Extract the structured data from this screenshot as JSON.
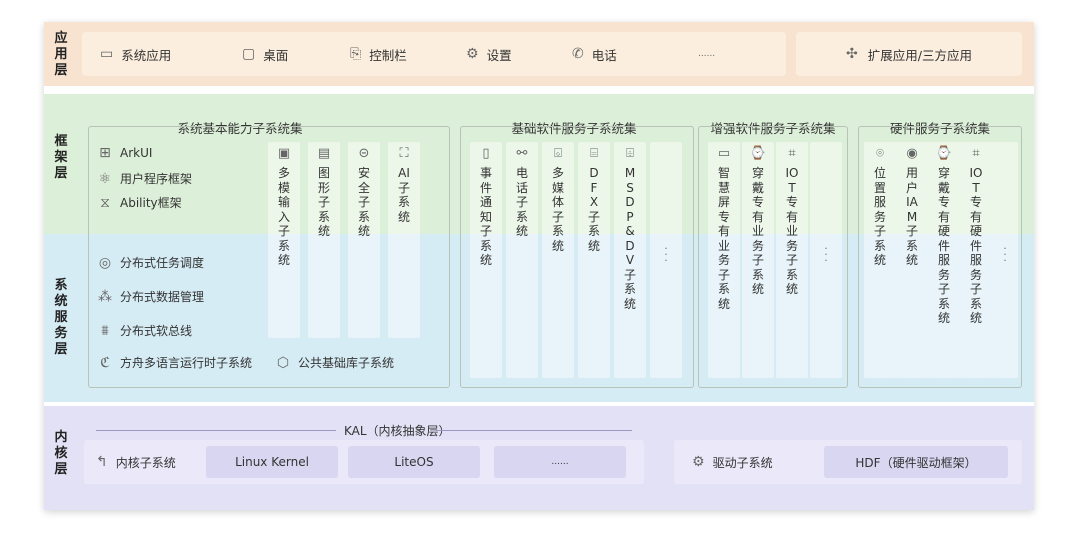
{
  "layers": {
    "app": "应用层",
    "framework": "框架层",
    "system": "系统服务层",
    "kernel": "内核层"
  },
  "app_layer": {
    "items": [
      {
        "label": "系统应用",
        "icon": "app-window-icon"
      },
      {
        "label": "桌面",
        "icon": "desktop-icon"
      },
      {
        "label": "控制栏",
        "icon": "control-bar-icon"
      },
      {
        "label": "设置",
        "icon": "gear-icon"
      },
      {
        "label": "电话",
        "icon": "phone-icon"
      },
      {
        "label": "......",
        "icon": ""
      }
    ],
    "extension": {
      "label": "扩展应用/三方应用",
      "icon": "puzzle-icon"
    }
  },
  "groups": [
    {
      "title": "系统基本能力子系统集",
      "side_items": [
        {
          "label": "ArkUI",
          "icon": "arkui-icon"
        },
        {
          "label": "用户程序框架",
          "icon": "atom-icon"
        },
        {
          "label": "Ability框架",
          "icon": "ability-icon"
        },
        {
          "label": "分布式任务调度",
          "icon": "task-schedule-icon"
        },
        {
          "label": "分布式数据管理",
          "icon": "data-manage-icon"
        },
        {
          "label": "分布式软总线",
          "icon": "softbus-icon"
        },
        {
          "label": "方舟多语言运行时子系统",
          "icon": "runtime-icon"
        },
        {
          "label": "公共基础库子系统",
          "icon": "cube-icon"
        }
      ],
      "columns": [
        {
          "label": "多模输入子系统",
          "icon": "input-icon"
        },
        {
          "label": "图形子系统",
          "icon": "graphics-icon"
        },
        {
          "label": "安全子系统",
          "icon": "security-icon"
        },
        {
          "label": "AI子系统",
          "icon": "ai-icon"
        }
      ]
    },
    {
      "title": "基础软件服务子系统集",
      "columns": [
        {
          "label": "事件通知子系统",
          "icon": "event-icon"
        },
        {
          "label": "电话子系统",
          "icon": "phone-sub-icon"
        },
        {
          "label": "多媒体子系统",
          "icon": "media-icon"
        },
        {
          "label": "DFX子系统",
          "icon": "dfx-icon"
        },
        {
          "label": "MSDP&DV子系统",
          "icon": "msdp-icon"
        },
        {
          "label": "",
          "icon": ""
        }
      ]
    },
    {
      "title": "增强软件服务子系统集",
      "columns": [
        {
          "label": "智慧屏专有业务子系统",
          "icon": "smart-screen-icon"
        },
        {
          "label": "穿戴专有业务子系统",
          "icon": "wearable-icon"
        },
        {
          "label": "IOT专有业务子系统",
          "icon": "iot-icon"
        },
        {
          "label": "",
          "icon": ""
        }
      ]
    },
    {
      "title": "硬件服务子系统集",
      "columns": [
        {
          "label": "位置服务子系统",
          "icon": "location-icon"
        },
        {
          "label": "用户IAM子系统",
          "icon": "iam-icon"
        },
        {
          "label": "穿戴专有硬件服务子系统",
          "icon": "wearable-hw-icon"
        },
        {
          "label": "IOT专有硬件服务子系统",
          "icon": "iot-hw-icon"
        },
        {
          "label": "",
          "icon": ""
        }
      ]
    }
  ],
  "kernel_layer": {
    "kal": "KAL（内核抽象层）",
    "kernel_subsystem": "内核子系统",
    "kernels": [
      "Linux Kernel",
      "LiteOS",
      "......"
    ],
    "driver_subsystem": "驱动子系统",
    "hdf": "HDF（硬件驱动框架）"
  }
}
